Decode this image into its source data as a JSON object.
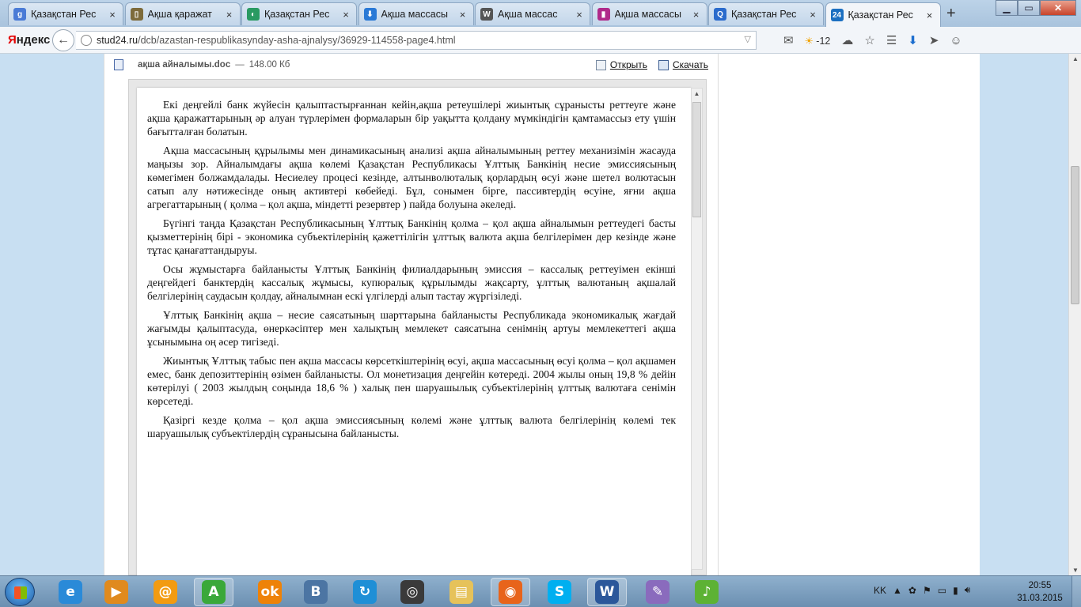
{
  "tabs": [
    {
      "title": "Қазақстан Рес",
      "icon": "google-icon",
      "color": "#4a7bd6",
      "glyph": "g"
    },
    {
      "title": "Ақша қаражат",
      "icon": "document-icon",
      "color": "#7d6b3b",
      "glyph": "▯"
    },
    {
      "title": "Қазақстан Рес",
      "icon": "globe-icon",
      "color": "#2a9a62",
      "glyph": "◐"
    },
    {
      "title": "Ақша массасы",
      "icon": "download-icon",
      "color": "#2979d6",
      "glyph": "⬇"
    },
    {
      "title": "Ақша массас",
      "icon": "wikipedia-icon",
      "color": "#555555",
      "glyph": "W"
    },
    {
      "title": "Ақша массасы",
      "icon": "chart-icon",
      "color": "#b02a8a",
      "glyph": "▮"
    },
    {
      "title": "Қазақстан Рес",
      "icon": "search-icon",
      "color": "#2a6bcc",
      "glyph": "Q"
    },
    {
      "title": "Қазақстан Рес",
      "icon": "site-24-icon",
      "color": "#1b6fc1",
      "glyph": "24",
      "active": true
    }
  ],
  "toolbar": {
    "brand_y": "Я",
    "brand_rest": "ндекс",
    "url_host": "stud24.ru",
    "url_path": "/dcb/azastan-respublikasynday-asha-ajnalysy/36929-114558-page4.html",
    "temperature": "-12"
  },
  "file": {
    "name": "ақша айналымы.doc",
    "separator": "—",
    "size": "148.00 Кб",
    "open_label": "Открыть",
    "download_label": "Скачать"
  },
  "document": {
    "paragraphs": [
      "Екі деңгейлі банк жүйесін қалыптастырғаннан  кейін,ақша ретеушілері жиынтық  сұранысты реттеуге  және ақша қаражаттарының әр алуан түрлерімен формаларын  бір уақытта  қолдану мүмкіндігін қамтамассыз  ету үшін  бағытталған болатын.",
      "Ақша массасының құрылымы мен динамикасының анализі ақша айналымының реттеу механизімін жасауда маңызы зор. Айналымдағы ақша көлемі Қазақстан Республикасы Ұлттық Банкінің несие эмиссиясының көмегімен болжамдалады. Несиелеу процесі кезінде, алтынволюталық қорлардың өсуі және шетел волютасын сатып алу нәтижесінде оның активтері көбейеді. Бұл, сонымен бірге, пассивтердің өсуіне, яғни ақша агрегаттарының ( қолма – қол ақша, міндетті резервтер ) пайда болуына әкеледі.",
      "Бүгінгі таңда Қазақстан Республикасының  Ұлттық Банкінің қолма – қол ақша айналымын реттеудегі басты қызметтерінің  бірі - экономика субъектілерінің  қажеттілігін ұлттық валюта ақша белгілерімен дер кезінде және тұтас қанағаттандыруы.",
      "Осы жұмыстарға байланысты Ұлттық Банкінің филиалдарының эмиссия – кассалық реттеуімен екінші деңгейдегі банктердің кассалық жұмысы, купюралық құрылымды жақсарту, ұлттық валютаның ақшалай белгілерінің саудасын қолдау, айналымнан ескі үлгілерді алып тастау жүргізіледі.",
      "Ұлттық Банкінің ақша – несие саясатының шарттарына байланысты Республикада экономикалық жағдай жағымды қалыптасуда, өнеркәсіптер мен халықтың мемлекет саясатына  сенімнің артуы мемлекеттегі ақша ұсынымына  оң әсер тигізеді.",
      "Жиынтық Ұлттық табыс пен ақша массасы көрсеткіштерінің өсуі, ақша массасының өсуі қолма – қол ақшамен емес, банк депозиттерінің өзімен байланысты. Ол монетизация деңгейін көтереді. 2004 жылы оның 19,8 % дейін көтерілуі ( 2003 жылдың соңында 18,6 % ) халық пен шаруашылық субъектілерінің ұлттық валютаға сенімін көрсетеді.",
      "Қазіргі кезде қолма – қол  ақша эмиссиясының көлемі және  ұлттық валюта белгілерінің көлемі тек шаруашылық субъектілердің  сұранысына байланысты."
    ]
  },
  "taskbar": {
    "items": [
      {
        "name": "internet-explorer-icon",
        "glyph": "e",
        "color": "#2a8ad8",
        "running": false
      },
      {
        "name": "media-player-icon",
        "glyph": "▶",
        "color": "#e08a1e",
        "running": false
      },
      {
        "name": "mail-agent-icon",
        "glyph": "@",
        "color": "#f29b11",
        "running": false
      },
      {
        "name": "green-a-icon",
        "glyph": "A",
        "color": "#3aa83a",
        "running": true
      },
      {
        "name": "odnoklassniki-icon",
        "glyph": "ok",
        "color": "#ee8208",
        "running": false
      },
      {
        "name": "vkontakte-icon",
        "glyph": "B",
        "color": "#4c75a3",
        "running": false
      },
      {
        "name": "refresh-app-icon",
        "glyph": "↻",
        "color": "#1f8fd6",
        "running": false
      },
      {
        "name": "speed-dial-icon",
        "glyph": "◎",
        "color": "#3a3a3a",
        "running": false
      },
      {
        "name": "folder-icon",
        "glyph": "▤",
        "color": "#e6c25a",
        "running": false
      },
      {
        "name": "firefox-icon",
        "glyph": "◉",
        "color": "#e8641b",
        "running": true
      },
      {
        "name": "skype-icon",
        "glyph": "S",
        "color": "#00aff0",
        "running": false
      },
      {
        "name": "word-icon",
        "glyph": "W",
        "color": "#2b579a",
        "running": true
      },
      {
        "name": "paint-icon",
        "glyph": "✎",
        "color": "#8a6bbd",
        "running": false
      },
      {
        "name": "music-icon",
        "glyph": "♪",
        "color": "#5db234",
        "running": false
      }
    ],
    "language": "KK",
    "time": "20:55",
    "date": "31.03.2015"
  }
}
